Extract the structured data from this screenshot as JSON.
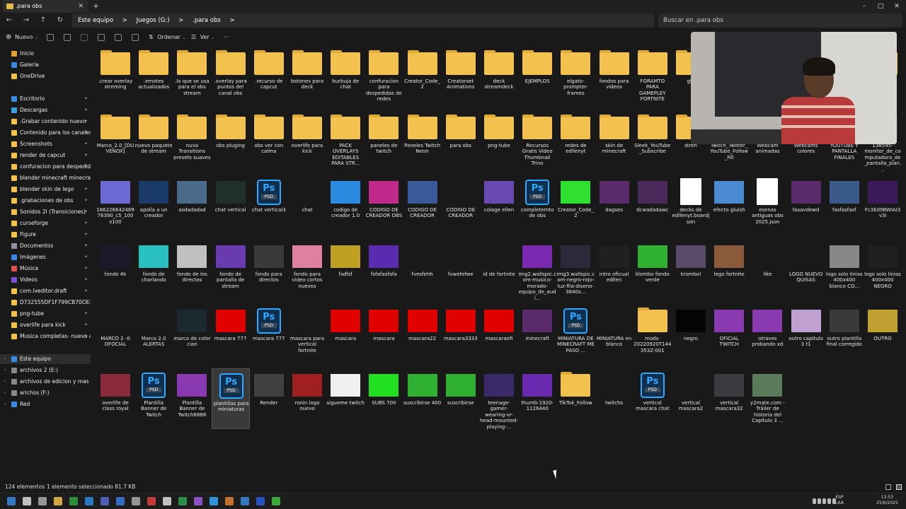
{
  "window": {
    "tab_title": ".para obs",
    "new_tab": "+",
    "minimize": "–",
    "maximize": "□",
    "close": "✕"
  },
  "address": {
    "segments": [
      "Este equipo",
      ">",
      "Juegos (G:)",
      ">",
      ".para obs",
      ">"
    ],
    "search_placeholder": "Buscar en .para obs"
  },
  "toolbar": {
    "new_label": "Nuevo",
    "sort_label": "Ordenar",
    "view_label": "Ver",
    "more": "···"
  },
  "sidebar": {
    "items": [
      {
        "label": "Inicio",
        "color": "#e0a030"
      },
      {
        "label": "Galería",
        "color": "#3a8ae0"
      },
      {
        "label": "OneDrive",
        "color": "#f2c14e"
      },
      {
        "label": "Escritorio",
        "color": "#3a8ae0"
      },
      {
        "label": "Descargas",
        "color": "#3aa0e0"
      },
      {
        "label": ".Grabar contenido nuevo",
        "color": "#f2c14e"
      },
      {
        "label": "Contenido para los canales",
        "color": "#f2c14e"
      },
      {
        "label": "Screenshots",
        "color": "#f2c14e"
      },
      {
        "label": "render de capcut",
        "color": "#f2c14e"
      },
      {
        "label": "confuracion para despedida",
        "color": "#f2c14e"
      },
      {
        "label": "blender minecraft minecraft",
        "color": "#f2c14e"
      },
      {
        "label": "blender skin de lego",
        "color": "#f2c14e"
      },
      {
        "label": ".grabaciones de obs",
        "color": "#f2c14e"
      },
      {
        "label": "Sonidos 2l (Transiciones)",
        "color": "#f2c14e"
      },
      {
        "label": "curseforge",
        "color": "#f2c14e"
      },
      {
        "label": "Figure",
        "color": "#f2c14e"
      },
      {
        "label": "Documentos",
        "color": "#9090a0"
      },
      {
        "label": "Imágenes",
        "color": "#3a8ae0"
      },
      {
        "label": "Música",
        "color": "#e05050"
      },
      {
        "label": "Videos",
        "color": "#8050d0"
      },
      {
        "label": "com.lveditor.draft",
        "color": "#f2c14e"
      },
      {
        "label": "D732555DF1F799CB70C677",
        "color": "#f2c14e"
      },
      {
        "label": "png-tube",
        "color": "#f2c14e"
      },
      {
        "label": "overlife para kick",
        "color": "#f2c14e"
      },
      {
        "label": "Musica completas- nuevo albu",
        "color": "#f2c14e"
      }
    ],
    "drives": [
      {
        "label": "Este equipo",
        "color": "#3a8ae0"
      },
      {
        "label": "archivos 2 (E:)",
        "color": "#888888"
      },
      {
        "label": "archivos de edicion y mas (D:)",
        "color": "#888888"
      },
      {
        "label": "arichos (F:)",
        "color": "#888888"
      },
      {
        "label": "Red",
        "color": "#3a8ae0"
      }
    ]
  },
  "files": [
    {
      "label": ".crear overlay streming",
      "type": "folder"
    },
    {
      "label": ".emotes actualizados",
      "type": "folder"
    },
    {
      "label": ".lo que se usa para el obs stream",
      "type": "folder"
    },
    {
      "label": ".overlay para puntos del canal obs",
      "type": "folder"
    },
    {
      "label": ".recurso de capcut",
      "type": "folder"
    },
    {
      "label": "botones para deck",
      "type": "folder"
    },
    {
      "label": "burbuja de chat",
      "type": "folder"
    },
    {
      "label": "confuracion para despedidas de redes",
      "type": "folder"
    },
    {
      "label": "Creator_Code_2",
      "type": "folder"
    },
    {
      "label": "Creatorset Animations",
      "type": "folder"
    },
    {
      "label": "deck streamdeck",
      "type": "folder"
    },
    {
      "label": "EJEMPLOS",
      "type": "folder"
    },
    {
      "label": "elgato-prompter-frames",
      "type": "folder"
    },
    {
      "label": "fondos para videos",
      "type": "folder"
    },
    {
      "label": "FORAMTO PARA GAMEPLEY FORTNITE",
      "type": "folder"
    },
    {
      "label": "glit",
      "type": "folder"
    },
    {
      "label": "",
      "type": "hidden"
    },
    {
      "label": "",
      "type": "hidden"
    },
    {
      "label": "",
      "type": "hidden"
    },
    {
      "label": "",
      "type": "hidden"
    },
    {
      "label": "LUT Profiles",
      "type": "folder"
    },
    {
      "label": "Marco_2.0_[DUVENOX]",
      "type": "folder"
    },
    {
      "label": "nuevo paquete de stream",
      "type": "folder"
    },
    {
      "label": "nuva Transitions presets suaves",
      "type": "folder"
    },
    {
      "label": "obs pluging",
      "type": "folder"
    },
    {
      "label": "obs ver con calma",
      "type": "folder"
    },
    {
      "label": "overlife para kick",
      "type": "folder"
    },
    {
      "label": "PACK OVERLAYS EDITABLES PARA STR...",
      "type": "folder"
    },
    {
      "label": "paneles de twitch",
      "type": "folder"
    },
    {
      "label": "Paneles Twitch Neon",
      "type": "folder"
    },
    {
      "label": "para obs",
      "type": "folder"
    },
    {
      "label": "png-tube",
      "type": "folder"
    },
    {
      "label": "Recursos Gratis Video Thumbnail Trino",
      "type": "folder"
    },
    {
      "label": "redes de edllenyt",
      "type": "folder"
    },
    {
      "label": "skin de minecraft",
      "type": "folder"
    },
    {
      "label": "Sleek_YouTube_Subscribe",
      "type": "folder"
    },
    {
      "label": "stren",
      "type": "folder"
    },
    {
      "label": "Twitch_Twitter_YouTube_Follow_Fill",
      "type": "folder"
    },
    {
      "label": "Webcam animadas",
      "type": "folder"
    },
    {
      "label": "Webcams colores",
      "type": "folder"
    },
    {
      "label": "YOUTUBE Y PANTALLA FINALES",
      "type": "folder"
    },
    {
      "label": "138595-monitor_de_computadora_de_pantalla_plan...",
      "type": "image",
      "color": "#2a2a40"
    },
    {
      "label": "16622664248976390_c5_100x100",
      "type": "image",
      "color": "#6a6ad0"
    },
    {
      "label": "apolla a un creador",
      "type": "image",
      "color": "#1a3a6a"
    },
    {
      "label": "asdadadad",
      "type": "image",
      "color": "#4a6a8a"
    },
    {
      "label": "chat vertical",
      "type": "image",
      "color": "#203028"
    },
    {
      "label": "chat vertical3",
      "type": "psd"
    },
    {
      "label": "chat",
      "type": "image",
      "color": "#191919"
    },
    {
      "label": "codigo de creador 1.0",
      "type": "image",
      "color": "#2a8ae0"
    },
    {
      "label": "CODIGO DE CREADOR OBS",
      "type": "image",
      "color": "#c02a8a"
    },
    {
      "label": "CODIGO DE CREADOR",
      "type": "image",
      "color": "#3a5a9a"
    },
    {
      "label": "CODIGO DE CREADOR",
      "type": "image",
      "color": "#191919"
    },
    {
      "label": "colage ellen",
      "type": "image",
      "color": "#6a4ab0"
    },
    {
      "label": "completemto de obs",
      "type": "psd"
    },
    {
      "label": "Creator_Code_2",
      "type": "image",
      "color": "#30e030"
    },
    {
      "label": "dagses",
      "type": "image",
      "color": "#5a2a6a"
    },
    {
      "label": "dcwadadawc",
      "type": "image",
      "color": "#4a2a5a"
    },
    {
      "label": "decks de edllenyt.boardjson",
      "type": "file"
    },
    {
      "label": "efecto gluish",
      "type": "image",
      "color": "#4a8ad0"
    },
    {
      "label": "esenas antiguas obs 2025.json",
      "type": "file"
    },
    {
      "label": "fasavdewd",
      "type": "image",
      "color": "#5a2a6a"
    },
    {
      "label": "fasfasfasf",
      "type": "image",
      "color": "#3a5a8a"
    },
    {
      "label": "Fc3Ed9BWIAI3v3i",
      "type": "image",
      "color": "#3a1a5a"
    },
    {
      "label": "fondo 4k",
      "type": "image",
      "color": "#1a1a2a"
    },
    {
      "label": "fondo de charlando",
      "type": "image",
      "color": "#2ac0c0"
    },
    {
      "label": "fondo de los directos",
      "type": "image",
      "color": "#c0c0c0"
    },
    {
      "label": "fondo de pantalla de stream",
      "type": "image",
      "color": "#6a3ab0"
    },
    {
      "label": "fondo para directos",
      "type": "image",
      "color": "#3a3a3a"
    },
    {
      "label": "fondo para video cortos nuevos",
      "type": "image",
      "color": "#e080a0"
    },
    {
      "label": "fsdfsf",
      "type": "image",
      "color": "#c0a020"
    },
    {
      "label": "fsfafasfafa",
      "type": "image",
      "color": "#5a2ab0"
    },
    {
      "label": "fvesfehh",
      "type": "image",
      "color": "#191919"
    },
    {
      "label": "fvwefefwe",
      "type": "image",
      "color": "#191919"
    },
    {
      "label": "id de fortnite",
      "type": "image",
      "color": "#191919"
    },
    {
      "label": "img2.wallspic.com-musico-morado-equipo_de_audi...",
      "type": "image",
      "color": "#7a2ab0"
    },
    {
      "label": "img3.wallspic.com-negro-rojo-luz-fila-diseno-3840x...",
      "type": "image",
      "color": "#2a2a3a"
    },
    {
      "label": "intro oficual edllen",
      "type": "image",
      "color": "#202020"
    },
    {
      "label": "klombo fondo verde",
      "type": "image",
      "color": "#30b030"
    },
    {
      "label": "krombol",
      "type": "image",
      "color": "#5a4a6a"
    },
    {
      "label": "lego fortnite",
      "type": "image",
      "color": "#8a5a3a"
    },
    {
      "label": "like",
      "type": "image",
      "color": "#191919"
    },
    {
      "label": "LOGO NUEVO QUISAS",
      "type": "image",
      "color": "#191919"
    },
    {
      "label": "logo solo linias 400x400 blanco CO...",
      "type": "image",
      "color": "#888888"
    },
    {
      "label": "logo solo linias 400x400 NEGRO",
      "type": "image",
      "color": "#202020"
    },
    {
      "label": "MARCO 2 -0 OFOCIAL",
      "type": "image",
      "color": "#191919"
    },
    {
      "label": "Marco 2.0 ALERTAS",
      "type": "image",
      "color": "#191919"
    },
    {
      "label": "marco de color cian",
      "type": "image",
      "color": "#1a2a30"
    },
    {
      "label": "mascara 777",
      "type": "image",
      "color": "#e00000"
    },
    {
      "label": "mascara 777",
      "type": "psd"
    },
    {
      "label": "mascara para vertical fortnite",
      "type": "image",
      "color": "#191919"
    },
    {
      "label": "mascara",
      "type": "image",
      "color": "#e00000"
    },
    {
      "label": "mascara",
      "type": "image",
      "color": "#e00000"
    },
    {
      "label": "mascara22",
      "type": "image",
      "color": "#e00000"
    },
    {
      "label": "mascara3333",
      "type": "image",
      "color": "#e00000"
    },
    {
      "label": "mascaraofi",
      "type": "image",
      "color": "#e00000"
    },
    {
      "label": "minecraft",
      "type": "image",
      "color": "#5a2a6a"
    },
    {
      "label": "MINIATURA DE MINECRAFT ME PASO ...",
      "type": "psd"
    },
    {
      "label": "MINIATURA en blanco",
      "type": "image",
      "color": "#191919"
    },
    {
      "label": "mods-20220920T144353Z-001",
      "type": "folder"
    },
    {
      "label": "negro",
      "type": "image",
      "color": "#050505"
    },
    {
      "label": "OFICIAL TWITCH",
      "type": "image",
      "color": "#8a3ab0"
    },
    {
      "label": "otraves probando xd",
      "type": "image",
      "color": "#8a3ab0"
    },
    {
      "label": "outro capitulo 3 t1",
      "type": "image",
      "color": "#c0a0d0"
    },
    {
      "label": "outro plantilla final corregido",
      "type": "image",
      "color": "#3a3a3a"
    },
    {
      "label": "OUTRO",
      "type": "image",
      "color": "#c0a030"
    },
    {
      "label": "overlife de class royal",
      "type": "image",
      "color": "#8a2a3a"
    },
    {
      "label": "Plantilla Banner de Twitch",
      "type": "psd"
    },
    {
      "label": "Plantilla Banner de Twitch8888",
      "type": "image",
      "color": "#8a3ab0"
    },
    {
      "label": "plantillas para miniaturas",
      "type": "psd",
      "selected": true
    },
    {
      "label": "Render",
      "type": "image",
      "color": "#404040"
    },
    {
      "label": "ronin logo nuevo",
      "type": "image",
      "color": "#a02020"
    },
    {
      "label": "sigueme twitch",
      "type": "image",
      "color": "#f0f0f0"
    },
    {
      "label": "SUBS 700",
      "type": "image",
      "color": "#20e020"
    },
    {
      "label": "suscribirse 400",
      "type": "image",
      "color": "#30b030"
    },
    {
      "label": "suscribirse",
      "type": "image",
      "color": "#30b030"
    },
    {
      "label": "teenage-gamer-wearing-vr-head-mounted-playing-...",
      "type": "image",
      "color": "#3a2a6a"
    },
    {
      "label": "thumb-1920-1126440",
      "type": "image",
      "color": "#6a2ab0"
    },
    {
      "label": "TikTok_Follow",
      "type": "folder"
    },
    {
      "label": "twitchs",
      "type": "image",
      "color": "#191919"
    },
    {
      "label": "vertical mascara chat",
      "type": "psd"
    },
    {
      "label": "vertical mascara2",
      "type": "image",
      "color": "#191919"
    },
    {
      "label": "vertical mascara32",
      "type": "image",
      "color": "#3a3a40"
    },
    {
      "label": "y2mate.com - Tráiler de historia del Capítulo 3 ...",
      "type": "image",
      "color": "#5a7a5a"
    }
  ],
  "psd_label": "Ps",
  "psd_tag": "PSD",
  "status": {
    "count": "124 elementos",
    "selected": "1 elemento seleccionado 81.7 KB"
  },
  "tray": {
    "lang": "ESP\nLAA",
    "time": "13:53",
    "date": "25/6/2025"
  }
}
